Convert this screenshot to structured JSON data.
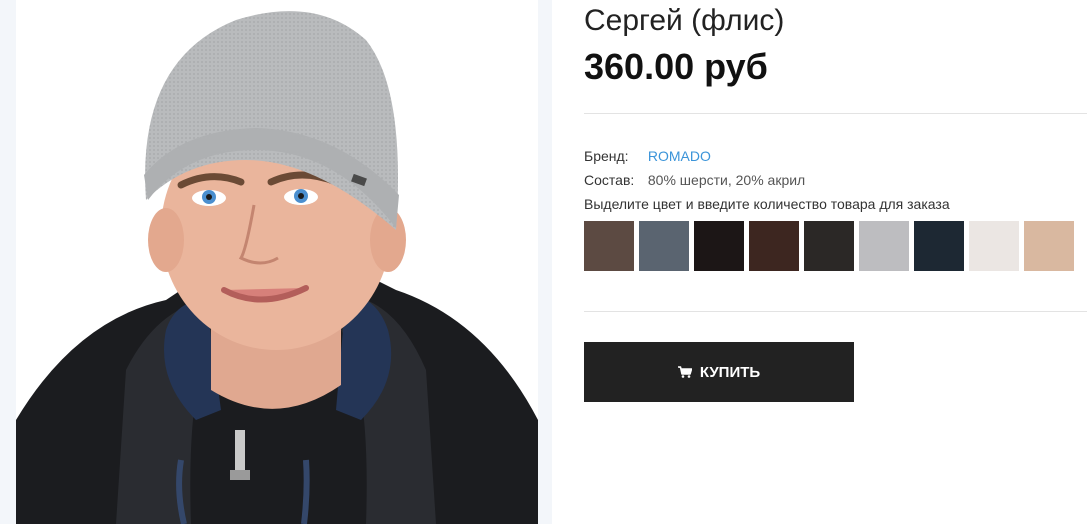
{
  "product": {
    "title": "Сергей (флис)",
    "price": "360.00 руб",
    "image_alt": "cap-photo"
  },
  "details": {
    "brand_label": "Бренд:",
    "brand_value": "ROMADO",
    "composition_label": "Состав:",
    "composition_value": "80% шерсти, 20% акрил",
    "instruction": "Выделите цвет и введите количество товара для заказа"
  },
  "swatches": [
    {
      "color": "#5c4a42"
    },
    {
      "color": "#5a6470"
    },
    {
      "color": "#1c1616"
    },
    {
      "color": "#3d2620"
    },
    {
      "color": "#2b2826"
    },
    {
      "color": "#bdbdc0"
    },
    {
      "color": "#1d2833"
    },
    {
      "color": "#ebe6e3"
    },
    {
      "color": "#d9b8a0"
    }
  ],
  "buy_button": {
    "label": "КУПИТЬ",
    "icon": "cart-icon"
  },
  "colors": {
    "accent_link": "#3b94d9",
    "button_bg": "#222222"
  }
}
